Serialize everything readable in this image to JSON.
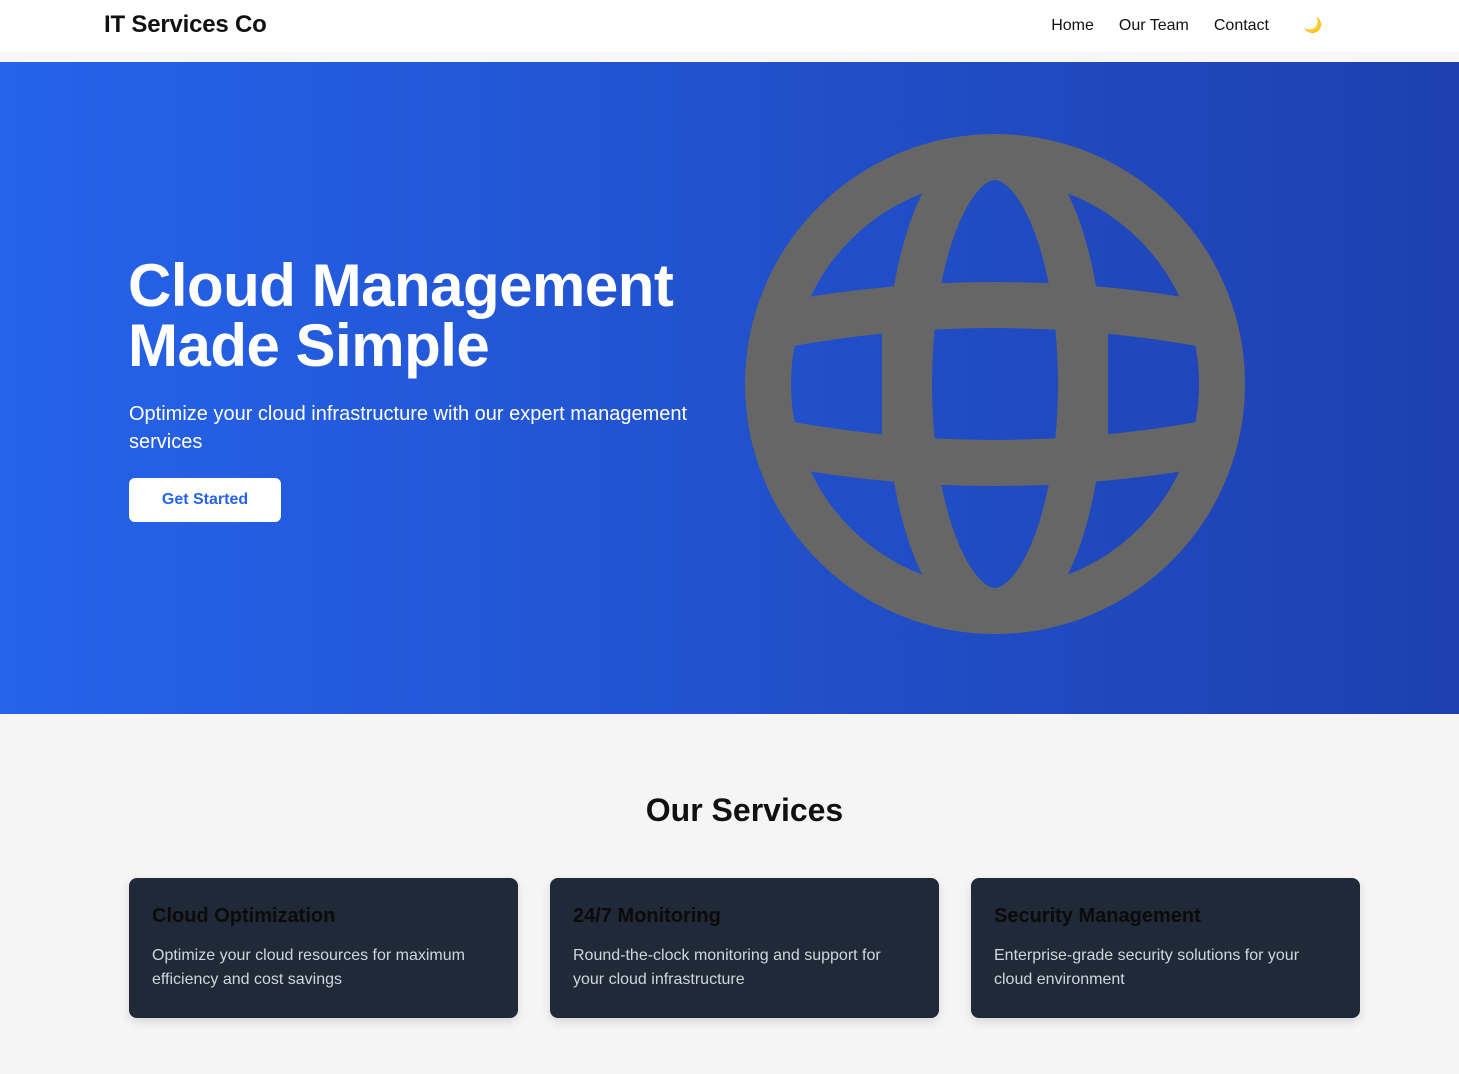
{
  "navbar": {
    "brand": "IT Services Co",
    "links": [
      "Home",
      "Our Team",
      "Contact"
    ],
    "theme_toggle_icon": "moon-icon",
    "theme_toggle_glyph": "🌙"
  },
  "hero": {
    "title_line1": "Cloud Management",
    "title_line2": "Made Simple",
    "subtitle": "Optimize your cloud infrastructure with our expert management services",
    "cta_label": "Get Started",
    "illustration_icon": "globe-icon",
    "gradient_start": "#2563eb",
    "gradient_end": "#1e40af",
    "globe_color": "#666666"
  },
  "services": {
    "title": "Our Services",
    "cards": [
      {
        "title": "Cloud Optimization",
        "description": "Optimize your cloud resources for maximum efficiency and cost savings"
      },
      {
        "title": "24/7 Monitoring",
        "description": "Round-the-clock monitoring and support for your cloud infrastructure"
      },
      {
        "title": "Security Management",
        "description": "Enterprise-grade security solutions for your cloud environment"
      }
    ],
    "card_background": "#1f2937"
  }
}
